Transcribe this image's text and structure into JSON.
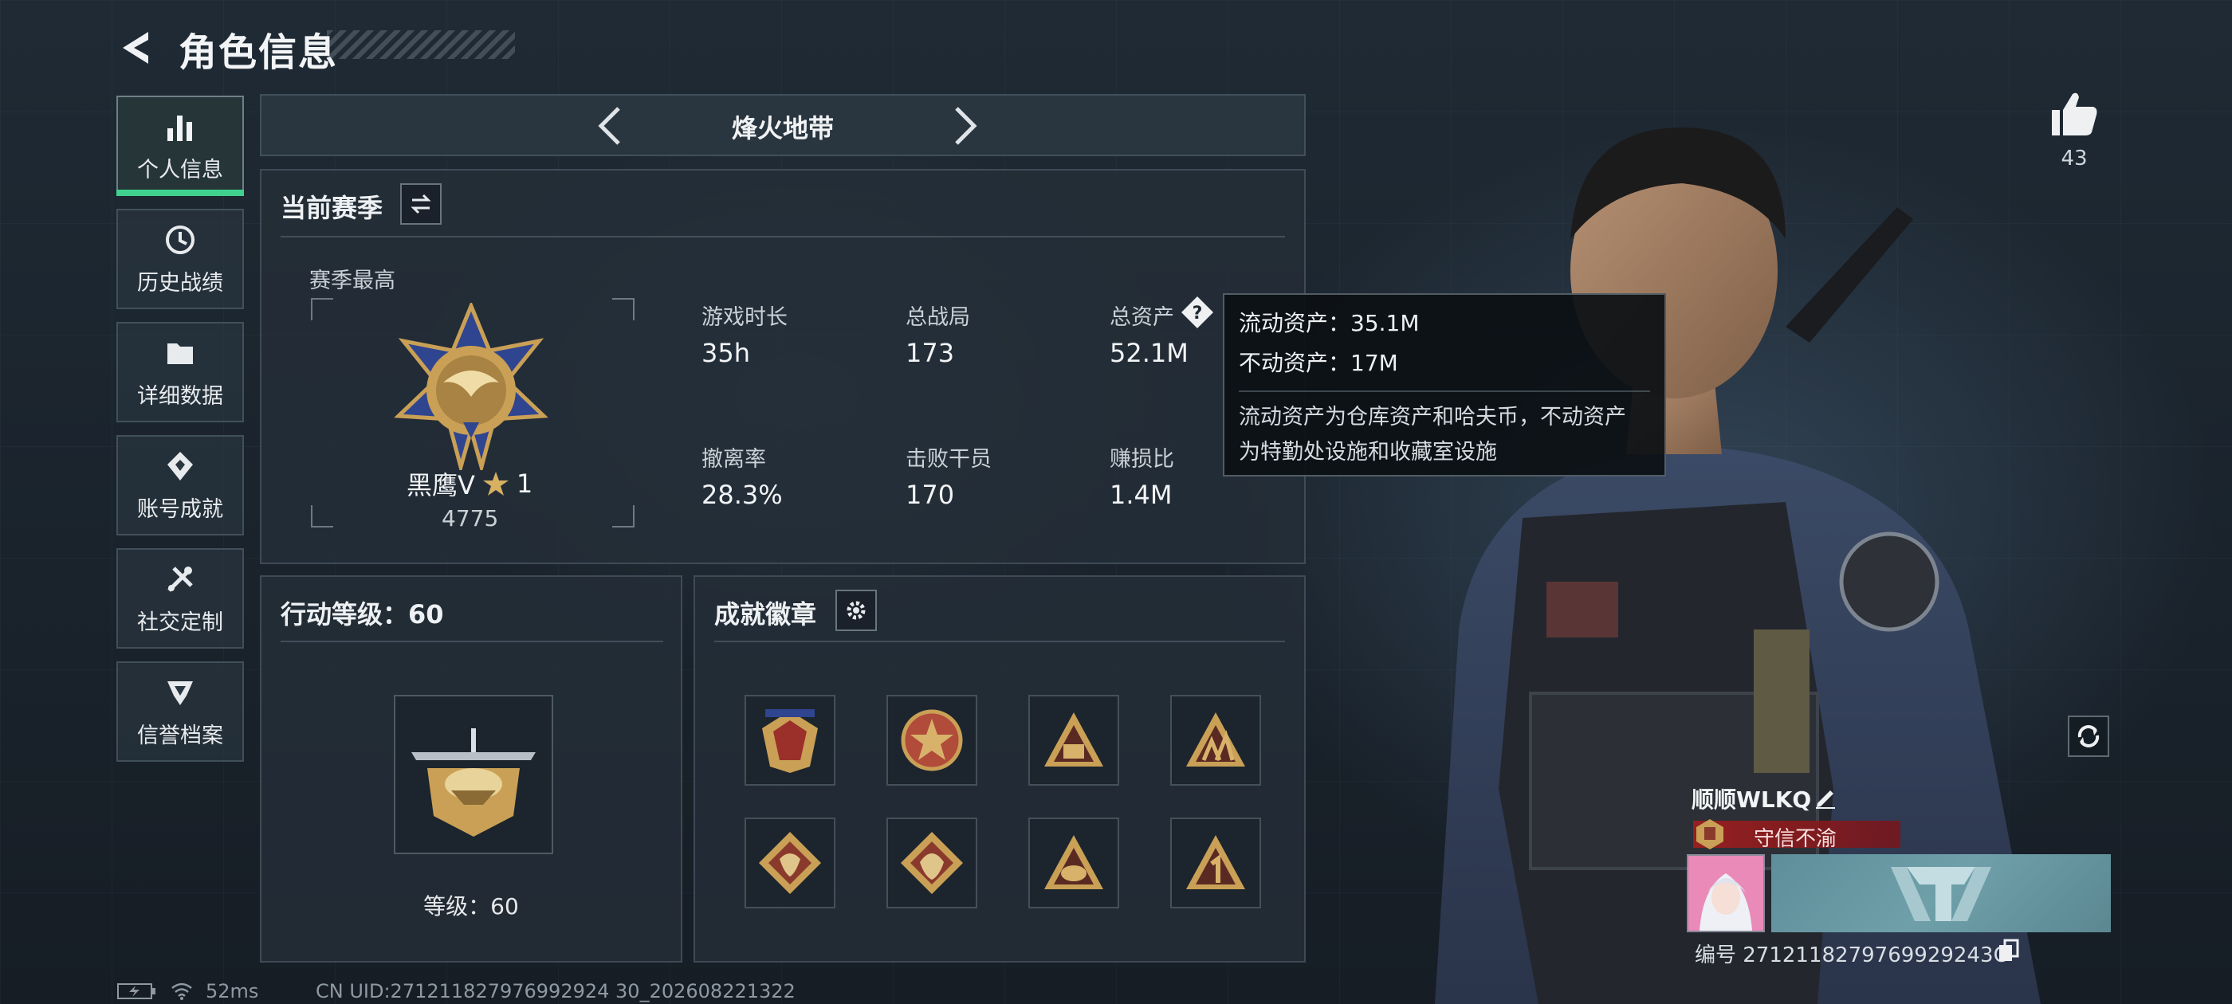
{
  "header": {
    "title": "角色信息"
  },
  "sidebar": {
    "items": [
      {
        "label": "个人信息",
        "icon": "bar-chart-icon",
        "active": true
      },
      {
        "label": "历史战绩",
        "icon": "history-clock-icon",
        "active": false
      },
      {
        "label": "详细数据",
        "icon": "folder-icon",
        "active": false
      },
      {
        "label": "账号成就",
        "icon": "achievement-badge-icon",
        "active": false
      },
      {
        "label": "社交定制",
        "icon": "tools-icon",
        "active": false
      },
      {
        "label": "信誉档案",
        "icon": "shield-icon",
        "active": false
      }
    ]
  },
  "map_selector": {
    "name": "烽火地带"
  },
  "season": {
    "title": "当前赛季",
    "best_label": "赛季最高",
    "rank_name": "黑鹰Ⅴ",
    "rank_stars": "1",
    "rank_points": "4775",
    "stats": [
      {
        "label": "游戏时长",
        "value": "35h"
      },
      {
        "label": "总战局",
        "value": "173"
      },
      {
        "label": "总资产",
        "value": "52.1M"
      },
      {
        "label": "撤离率",
        "value": "28.3%"
      },
      {
        "label": "击败干员",
        "value": "170"
      },
      {
        "label": "赚损比",
        "value": "1.4M"
      }
    ]
  },
  "tooltip": {
    "liquid": "流动资产：35.1M",
    "fixed": "不动资产：17M",
    "desc_line1": "流动资产为仓库资产和哈夫币，不动资产",
    "desc_line2": "为特勤处设施和收藏室设施"
  },
  "action_level": {
    "title": "行动等级：60",
    "level_text": "等级：60"
  },
  "badges": {
    "title": "成就徽章",
    "items": [
      "badge-1-icon",
      "badge-2-icon",
      "badge-3-icon",
      "badge-4-icon",
      "badge-5-icon",
      "badge-6-icon",
      "badge-7-icon",
      "badge-8-icon"
    ]
  },
  "profile": {
    "likes": "43",
    "name": "顺顺WLKQ",
    "title_tag": "守信不渝",
    "uid_line": "编号 2712118279769929243O"
  },
  "status_bar": {
    "ping": "52ms",
    "uid_footer": "CN UID:271211827976992924 30_202608221322"
  },
  "colors": {
    "accent_active": "#3fd28f",
    "tag_red": "#a01e1e",
    "gold": "#c9a056"
  }
}
